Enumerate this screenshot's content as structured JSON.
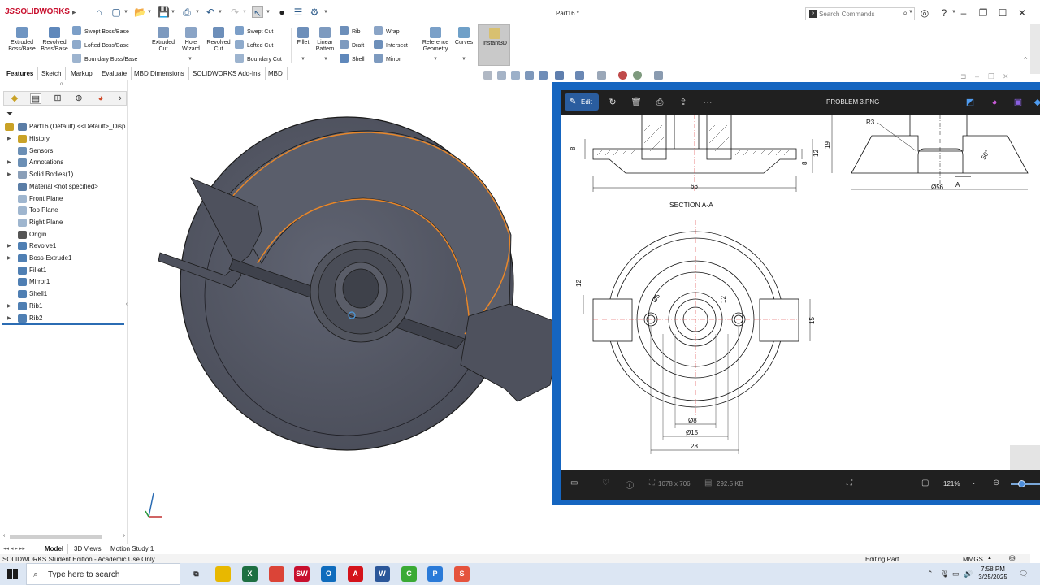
{
  "app": {
    "brand": "SOLIDWORKS",
    "document_title": "Part16 *",
    "search_placeholder": "Search Commands"
  },
  "ribbon": {
    "extruded_boss": "Extruded\nBoss/Base",
    "revolved_boss": "Revolved\nBoss/Base",
    "swept_boss": "Swept Boss/Base",
    "lofted_boss": "Lofted Boss/Base",
    "boundary_boss": "Boundary Boss/Base",
    "extruded_cut": "Extruded\nCut",
    "hole_wizard": "Hole\nWizard",
    "revolved_cut": "Revolved\nCut",
    "swept_cut": "Swept Cut",
    "lofted_cut": "Lofted Cut",
    "boundary_cut": "Boundary Cut",
    "fillet": "Fillet",
    "linear_pattern": "Linear\nPattern",
    "rib": "Rib",
    "draft": "Draft",
    "shell": "Shell",
    "wrap": "Wrap",
    "intersect": "Intersect",
    "mirror": "Mirror",
    "reference_geometry": "Reference\nGeometry",
    "curves": "Curves",
    "instant3d": "Instant3D"
  },
  "cm_tabs": [
    "Features",
    "Sketch",
    "Markup",
    "Evaluate",
    "MBD Dimensions",
    "SOLIDWORKS Add-Ins",
    "MBD"
  ],
  "tree": {
    "root": "Part16 (Default) <<Default>_Disp",
    "items": [
      {
        "label": "History",
        "expandable": true,
        "color": "#c9a227"
      },
      {
        "label": "Sensors",
        "expandable": false,
        "color": "#6b8fb5"
      },
      {
        "label": "Annotations",
        "expandable": true,
        "color": "#6b8fb5"
      },
      {
        "label": "Solid Bodies(1)",
        "expandable": true,
        "color": "#8a9fb8"
      },
      {
        "label": "Material <not specified>",
        "expandable": false,
        "color": "#5a7da6"
      },
      {
        "label": "Front Plane",
        "expandable": false,
        "color": "#9fb6cf"
      },
      {
        "label": "Top Plane",
        "expandable": false,
        "color": "#9fb6cf"
      },
      {
        "label": "Right Plane",
        "expandable": false,
        "color": "#9fb6cf"
      },
      {
        "label": "Origin",
        "expandable": false,
        "color": "#555555"
      },
      {
        "label": "Revolve1",
        "expandable": true,
        "color": "#4f7fb3"
      },
      {
        "label": "Boss-Extrude1",
        "expandable": true,
        "color": "#4f7fb3"
      },
      {
        "label": "Fillet1",
        "expandable": false,
        "color": "#4f7fb3"
      },
      {
        "label": "Mirror1",
        "expandable": false,
        "color": "#4f7fb3"
      },
      {
        "label": "Shell1",
        "expandable": false,
        "color": "#4f7fb3"
      },
      {
        "label": "Rib1",
        "expandable": true,
        "color": "#4f7fb3"
      },
      {
        "label": "Rib2",
        "expandable": true,
        "color": "#4f7fb3"
      }
    ]
  },
  "bottom_tabs": [
    "Model",
    "3D Views",
    "Motion Study 1"
  ],
  "status": {
    "left": "SOLIDWORKS Student Edition - Academic Use Only",
    "mode": "Editing Part",
    "units": "MMGS"
  },
  "viewer": {
    "edit_label": "Edit",
    "title": "PROBLEM 3.PNG",
    "dimensions": "1078 x 706",
    "file_size": "292.5 KB",
    "zoom": "121%",
    "drawing": {
      "section_label": "SECTION A-A",
      "dims": {
        "d8_left": "8",
        "d12": "12",
        "d8_right": "8",
        "d19": "19",
        "d66": "66",
        "r3": "R3",
        "ang50": "50°",
        "dia56": "Ø56",
        "a_marker": "A",
        "d12_top": "12",
        "dia5": "Ø5",
        "d12_mid": "12",
        "d15_side": "15",
        "dia8": "Ø8",
        "dia15": "Ø15",
        "d28": "28"
      }
    }
  },
  "taskbar": {
    "search_placeholder": "Type here to search",
    "time": "7:58 PM",
    "date": "3/25/2025",
    "apps": [
      {
        "name": "task-view",
        "color": "#dce6f3",
        "glyph": "⧉"
      },
      {
        "name": "file-explorer",
        "color": "#e8b800",
        "glyph": ""
      },
      {
        "name": "excel",
        "color": "#1d6f42",
        "glyph": "X"
      },
      {
        "name": "chrome",
        "color": "#db4437",
        "glyph": ""
      },
      {
        "name": "solidworks",
        "color": "#c8102e",
        "glyph": "SW"
      },
      {
        "name": "outlook",
        "color": "#0f6cbd",
        "glyph": "O"
      },
      {
        "name": "acrobat",
        "color": "#d4131b",
        "glyph": "A"
      },
      {
        "name": "word",
        "color": "#2b579a",
        "glyph": "W"
      },
      {
        "name": "camtasia",
        "color": "#3aaa35",
        "glyph": "C"
      },
      {
        "name": "paint",
        "color": "#2a7ad8",
        "glyph": "P"
      },
      {
        "name": "snip",
        "color": "#e5533d",
        "glyph": "S"
      }
    ]
  }
}
